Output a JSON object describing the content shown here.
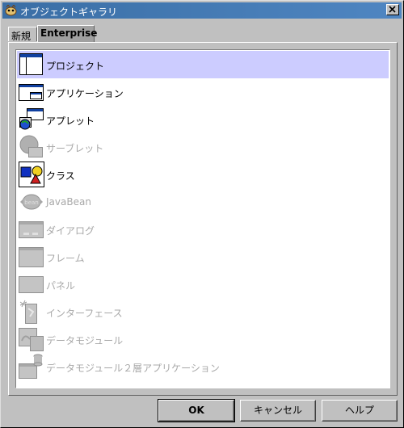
{
  "window": {
    "title": "オブジェクトギャラリ"
  },
  "tabs": [
    {
      "label": "新規",
      "active": false
    },
    {
      "label": "Enterprise",
      "active": true
    }
  ],
  "items": [
    {
      "label": "プロジェクト",
      "icon": "project-icon",
      "enabled": true,
      "selected": true
    },
    {
      "label": "アプリケーション",
      "icon": "application-icon",
      "enabled": true,
      "selected": false
    },
    {
      "label": "アプレット",
      "icon": "applet-icon",
      "enabled": true,
      "selected": false
    },
    {
      "label": "サーブレット",
      "icon": "servlet-icon",
      "enabled": false,
      "selected": false
    },
    {
      "label": "クラス",
      "icon": "class-icon",
      "enabled": true,
      "selected": false
    },
    {
      "label": "JavaBean",
      "icon": "javabean-icon",
      "enabled": false,
      "selected": false
    },
    {
      "label": "ダイアログ",
      "icon": "dialog-icon",
      "enabled": false,
      "selected": false
    },
    {
      "label": "フレーム",
      "icon": "frame-icon",
      "enabled": false,
      "selected": false
    },
    {
      "label": "パネル",
      "icon": "panel-icon",
      "enabled": false,
      "selected": false
    },
    {
      "label": "インターフェース",
      "icon": "interface-icon",
      "enabled": false,
      "selected": false
    },
    {
      "label": "データモジュール",
      "icon": "data-module-icon",
      "enabled": false,
      "selected": false
    },
    {
      "label": "データモジュール２層アプリケーション",
      "icon": "data-module-two-tier-icon",
      "enabled": false,
      "selected": false
    }
  ],
  "buttons": {
    "ok": "OK",
    "cancel": "キャンセル",
    "help": "ヘルプ"
  },
  "colors": {
    "titlebar": "#3a6ea5",
    "selection": "#ccccff",
    "disabled_text": "#a8a8a8"
  }
}
